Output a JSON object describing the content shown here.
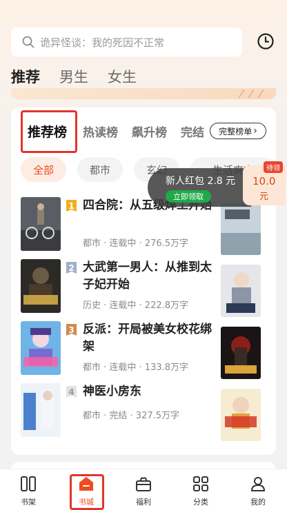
{
  "search": {
    "placeholder": "诡异怪谈：我的死因不正常"
  },
  "top_tabs": [
    {
      "label": "推荐",
      "active": true
    },
    {
      "label": "男生",
      "active": false
    },
    {
      "label": "女生",
      "active": false
    }
  ],
  "rank_tabs": {
    "items": [
      "推荐榜",
      "热读榜",
      "飙升榜",
      "完结"
    ],
    "full_list": "完整榜单",
    "full_list_arrow": "›"
  },
  "categories": [
    "全部",
    "都市",
    "玄幻",
    "生活爽文"
  ],
  "books": [
    {
      "rank": "1",
      "rank_color": "#f2b01e",
      "title": "四合院：从五级焊工开始",
      "meta": "都市 · 连载中 · 276.5万字"
    },
    {
      "rank": "2",
      "rank_color": "#9fb0c9",
      "title": "大武第一男人：从推到太子妃开始",
      "meta": "历史 · 连载中 · 222.8万字"
    },
    {
      "rank": "3",
      "rank_color": "#d08a4a",
      "title": "反派：开局被美女校花绑架",
      "meta": "都市 · 连载中 · 133.8万字"
    },
    {
      "rank": "4",
      "rank_color": "#e3e3e3",
      "title": "神医小房东",
      "meta": "都市 · 完结 · 327.5万字"
    }
  ],
  "toast": {
    "title": "新人红包 2.8 元",
    "button": "立即领取"
  },
  "coupon": {
    "tag": "待领",
    "amount": "10.0",
    "unit": "元"
  },
  "nav": [
    {
      "label": "书架",
      "icon": "bookshelf-icon",
      "active": false
    },
    {
      "label": "书城",
      "icon": "bookstore-icon",
      "active": true
    },
    {
      "label": "福利",
      "icon": "gift-icon",
      "active": false
    },
    {
      "label": "分类",
      "icon": "category-icon",
      "active": false
    },
    {
      "label": "我的",
      "icon": "profile-icon",
      "active": false
    }
  ],
  "colors": {
    "accent": "#f04b1f",
    "highlight_box": "#e0352b",
    "claim_green": "#1faa4a"
  }
}
